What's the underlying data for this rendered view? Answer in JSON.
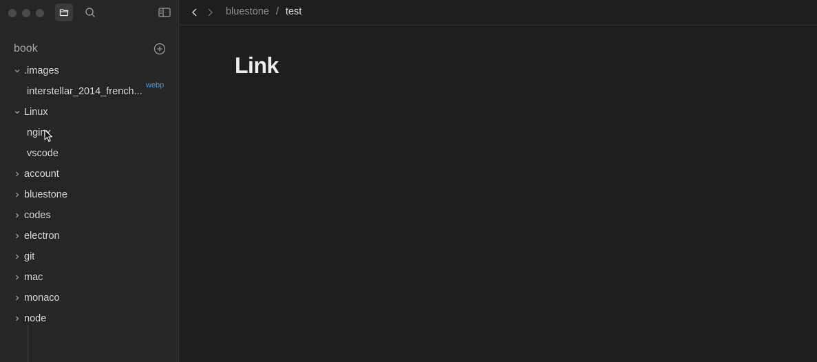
{
  "sidebar": {
    "workspace_title": "book",
    "items": [
      {
        "label": ".images",
        "type": "folder",
        "expanded": true
      },
      {
        "label": "interstellar_2014_french...",
        "type": "file",
        "badge": "webp"
      },
      {
        "label": "Linux",
        "type": "folder",
        "expanded": true
      },
      {
        "label": "nginx",
        "type": "file"
      },
      {
        "label": "vscode",
        "type": "file"
      },
      {
        "label": "account",
        "type": "folder",
        "expanded": false
      },
      {
        "label": "bluestone",
        "type": "folder",
        "expanded": false
      },
      {
        "label": "codes",
        "type": "folder",
        "expanded": false
      },
      {
        "label": "electron",
        "type": "folder",
        "expanded": false
      },
      {
        "label": "git",
        "type": "folder",
        "expanded": false
      },
      {
        "label": "mac",
        "type": "folder",
        "expanded": false
      },
      {
        "label": "monaco",
        "type": "folder",
        "expanded": false
      },
      {
        "label": "node",
        "type": "folder",
        "expanded": false
      }
    ]
  },
  "breadcrumb": {
    "parent": "bluestone",
    "separator": "/",
    "current": "test"
  },
  "document": {
    "title": "Link"
  },
  "colors": {
    "accent": "#3b9be0",
    "sidebar_bg": "#262626",
    "editor_bg": "#1e1e1e"
  }
}
